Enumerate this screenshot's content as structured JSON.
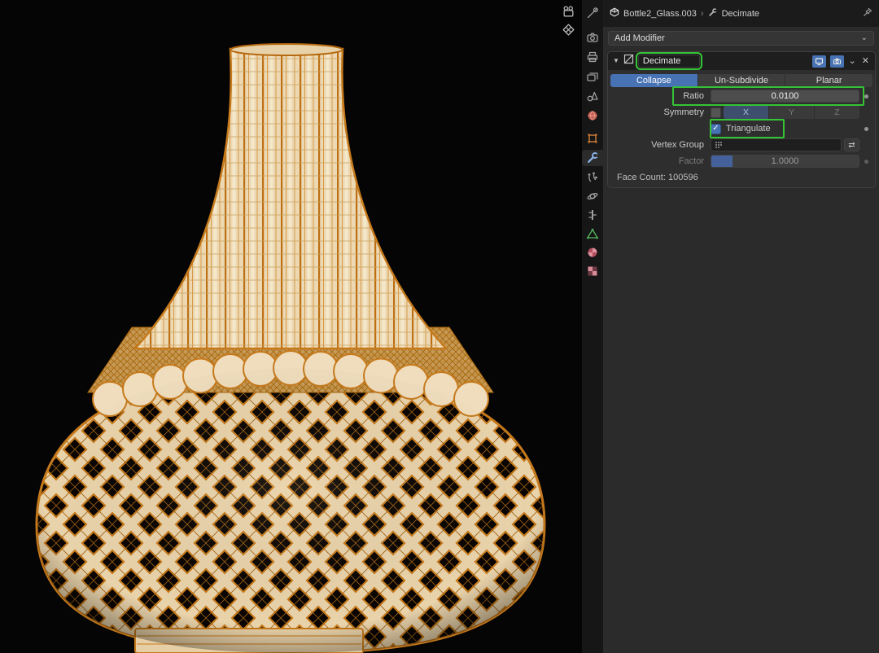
{
  "icons": {
    "expand": "▼",
    "chevron_down": "⌄",
    "close": "✕",
    "check": "✓",
    "swap": "⇄",
    "decorator": "•",
    "separator": "›"
  },
  "viewport": {
    "wire_color": "#c67a1c",
    "surface_color": "#ecd8b2",
    "background": "#060505",
    "overlay_icons": [
      "camera-gizmo",
      "grid-gizmo"
    ]
  },
  "tabstrip": {
    "tabs": [
      "tool",
      "render",
      "output",
      "view-layer",
      "scene",
      "world",
      "object",
      "modifier-properties",
      "particles",
      "physics",
      "constraints",
      "object-data",
      "material",
      "texture"
    ],
    "active": "modifier-properties"
  },
  "panel": {
    "breadcrumb": {
      "object": "Bottle2_Glass.003",
      "separator": "›",
      "modifier": "Decimate"
    },
    "add_modifier": "Add Modifier",
    "decimate": {
      "name": "Decimate",
      "modes": [
        "Collapse",
        "Un-Subdivide",
        "Planar"
      ],
      "active_mode": "Collapse",
      "ratio": {
        "label": "Ratio",
        "value": "0.0100"
      },
      "symmetry": {
        "label": "Symmetry",
        "axes": [
          "X",
          "Y",
          "Z"
        ],
        "active_axis": "X",
        "enabled": false
      },
      "triangulate": {
        "label": "Triangulate",
        "checked": true
      },
      "vertex_group": {
        "label": "Vertex Group",
        "value": ""
      },
      "factor": {
        "label": "Factor",
        "value": "1.0000",
        "disabled": true
      },
      "face_count": "Face Count: 100596"
    },
    "colors": {
      "accent": "#4772b3",
      "annotation": "#35c435"
    }
  }
}
